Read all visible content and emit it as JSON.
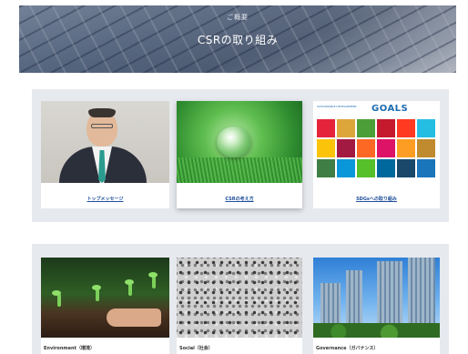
{
  "hero": {
    "subtitle": "ご概要",
    "title": "CSRの取り組み"
  },
  "row1": {
    "cards": [
      {
        "label": "トップメッセージ",
        "image": "portrait-photo"
      },
      {
        "label": "CSRの考え方",
        "image": "water-drop-photo"
      },
      {
        "label": "SDGsへの取り組み",
        "image": "sdgs-goals-graphic"
      }
    ]
  },
  "row2": {
    "cards": [
      {
        "label": "Environment（環境）",
        "image": "seedling-photo"
      },
      {
        "label": "Social（社会）",
        "image": "crowd-photo"
      },
      {
        "label": "Governance（ガバナンス）",
        "image": "skyscrapers-photo"
      }
    ]
  },
  "sdgs": {
    "small_text": "SUSTAINABLE DEVELOPMENT",
    "goals_text": "GOALS",
    "tile_colors": [
      "#e5243b",
      "#dda63a",
      "#4c9f38",
      "#c5192d",
      "#ff3a21",
      "#26bde2",
      "#fcc30b",
      "#a21942",
      "#fd6925",
      "#dd1367",
      "#fd9d24",
      "#bf8b2e",
      "#3f7e44",
      "#0a97d9",
      "#56c02b",
      "#00689d",
      "#19486a",
      "#1a75bb"
    ]
  },
  "colors": {
    "section_bg": "#e6e9ee",
    "link": "#1f4e9a"
  }
}
